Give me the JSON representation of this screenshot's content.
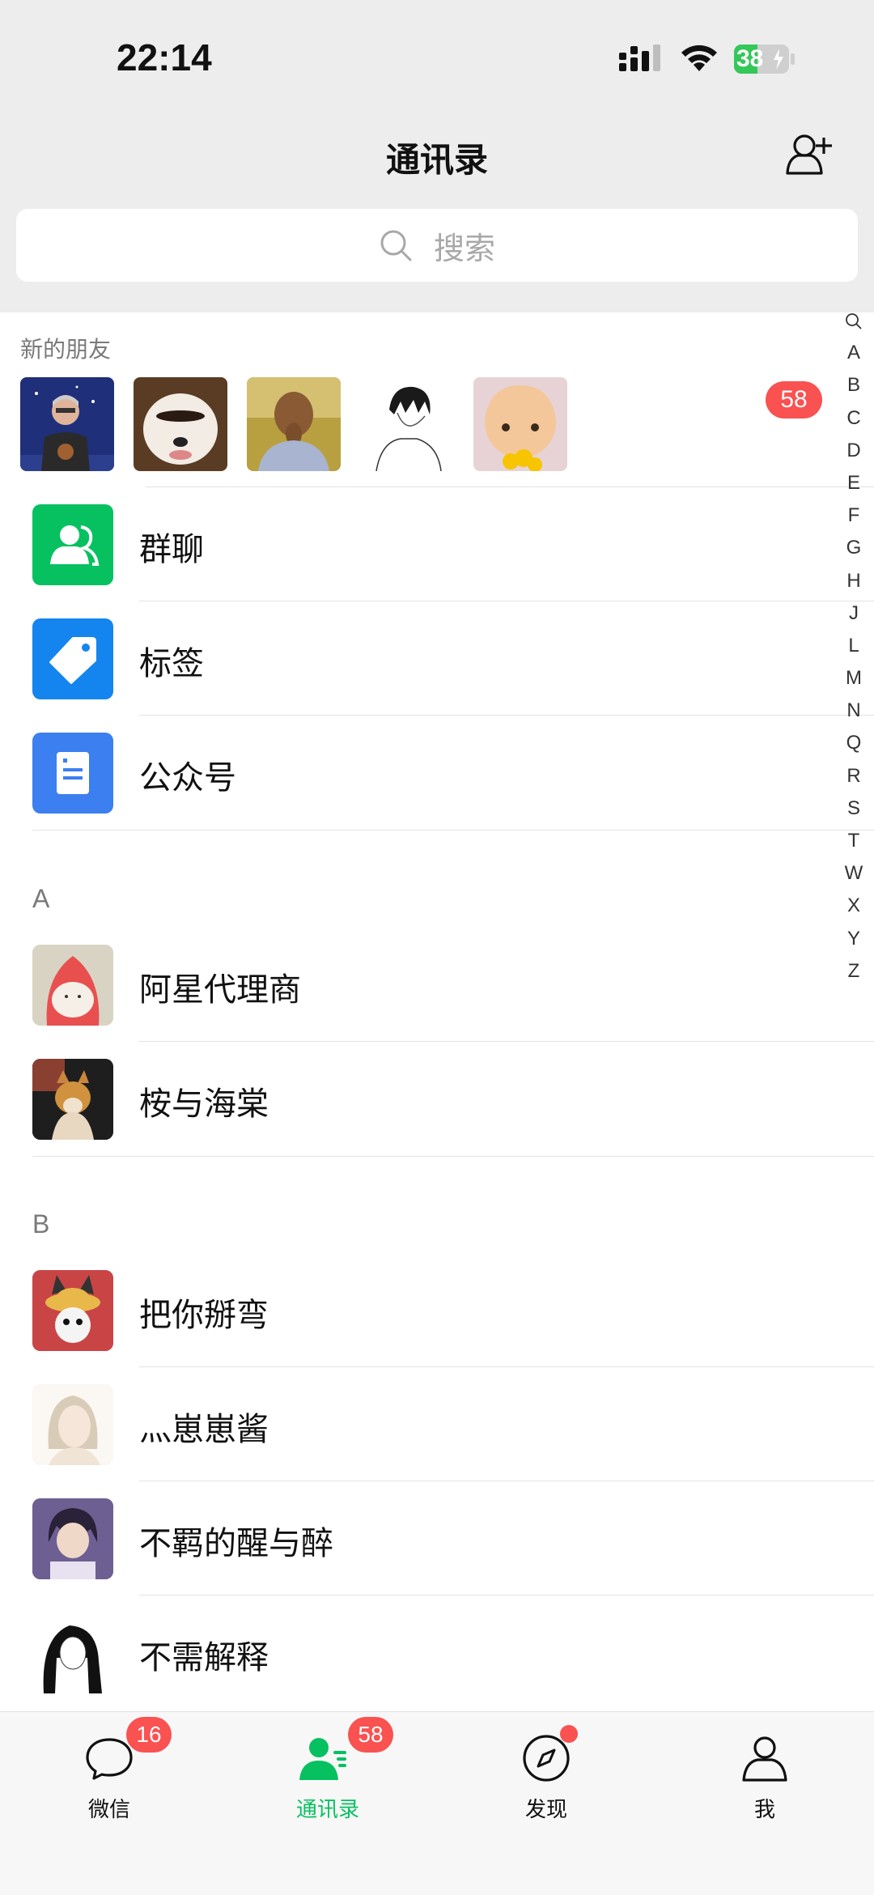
{
  "status_bar": {
    "time": "22:14",
    "battery": "38"
  },
  "header": {
    "title": "通讯录"
  },
  "search": {
    "placeholder": "搜索"
  },
  "new_friends": {
    "label": "新的朋友",
    "badge": "58"
  },
  "features": [
    {
      "label": "群聊",
      "icon": "group-chat-icon",
      "color": "#07c160"
    },
    {
      "label": "标签",
      "icon": "tag-icon",
      "color": "#1485ee"
    },
    {
      "label": "公众号",
      "icon": "official-account-icon",
      "color": "#3c7ff0"
    }
  ],
  "sections": [
    {
      "letter": "A",
      "contacts": [
        "阿星代理商",
        "桉与海棠"
      ]
    },
    {
      "letter": "B",
      "contacts": [
        "把你掰弯",
        "灬崽崽酱",
        "不羁的醒与醉",
        "不需解释"
      ]
    }
  ],
  "index_letters": [
    "A",
    "B",
    "C",
    "D",
    "E",
    "F",
    "G",
    "H",
    "J",
    "L",
    "M",
    "N",
    "Q",
    "R",
    "S",
    "T",
    "W",
    "X",
    "Y",
    "Z"
  ],
  "tabbar": {
    "tabs": [
      {
        "label": "微信",
        "badge": "16"
      },
      {
        "label": "通讯录",
        "badge": "58"
      },
      {
        "label": "发现"
      },
      {
        "label": "我"
      }
    ],
    "active_color": "#07c160"
  }
}
